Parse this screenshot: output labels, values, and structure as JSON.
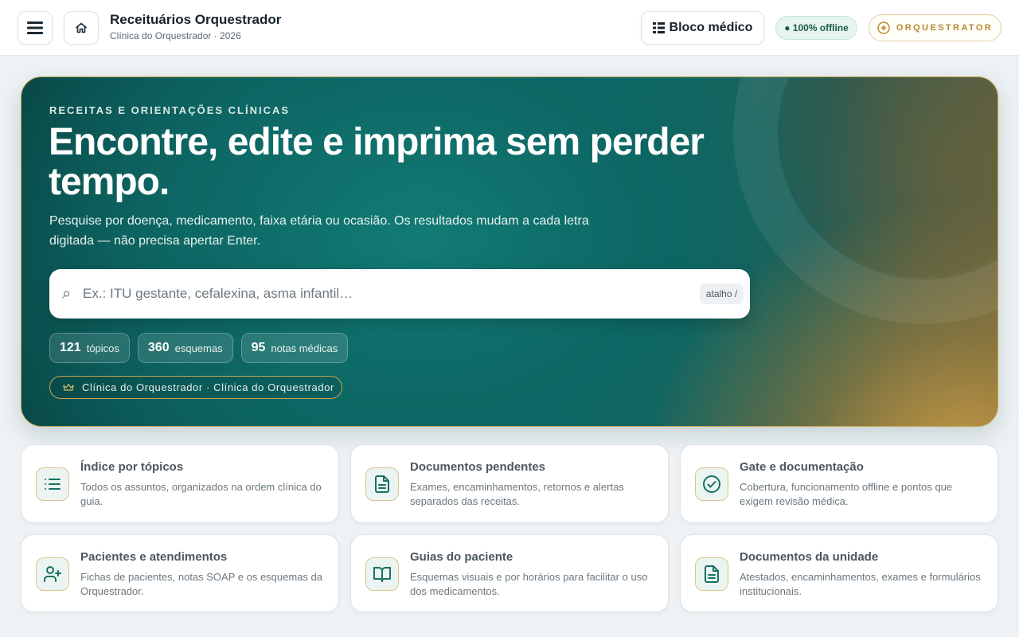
{
  "header": {
    "title": "Receituários Orquestrador",
    "subtitle": "Clínica do Orquestrador · 2026",
    "bloco_label": "Bloco médico",
    "offline_label": "● 100% offline",
    "brand_label": "ORQUESTRATOR"
  },
  "hero": {
    "kicker": "RECEITAS E ORIENTAÇÕES CLÍNICAS",
    "title": "Encontre, edite e imprima sem perder tempo.",
    "description": "Pesquise por doença, medicamento, faixa etária ou ocasião. Os resultados mudam a cada letra digitada — não precisa apertar Enter.",
    "search_placeholder": "Ex.: ITU gestante, cefalexina, asma infantil…",
    "search_value": "",
    "shortcut": "atalho /",
    "stats": [
      {
        "value": "121",
        "label": "tópicos"
      },
      {
        "value": "360",
        "label": "esquemas"
      },
      {
        "value": "95",
        "label": "notas médicas"
      }
    ],
    "clinic_pill": "Clínica do Orquestrador · Clínica do Orquestrador"
  },
  "cards": [
    {
      "title": "Índice por tópicos",
      "desc": "Todos os assuntos, organizados na ordem clínica do guia.",
      "icon": "list-icon"
    },
    {
      "title": "Documentos pendentes",
      "desc": "Exames, encaminhamentos, retornos e alertas separados das receitas.",
      "icon": "document-icon"
    },
    {
      "title": "Gate e documentação",
      "desc": "Cobertura, funcionamento offline e pontos que exigem revisão médica.",
      "icon": "check-circle-icon"
    },
    {
      "title": "Pacientes e atendimentos",
      "desc": "Fichas de pacientes, notas SOAP e os esquemas da Orquestrador.",
      "icon": "user-plus-icon"
    },
    {
      "title": "Guias do paciente",
      "desc": "Esquemas visuais e por horários para facilitar o uso dos medicamentos.",
      "icon": "book-icon"
    },
    {
      "title": "Documentos da unidade",
      "desc": "Atestados, encaminhamentos, exames e formulários institucionais.",
      "icon": "document-icon"
    }
  ],
  "colors": {
    "accent_teal": "#0f6f6a",
    "accent_gold": "#c7a450",
    "icon_stroke": "#1a6f62"
  }
}
